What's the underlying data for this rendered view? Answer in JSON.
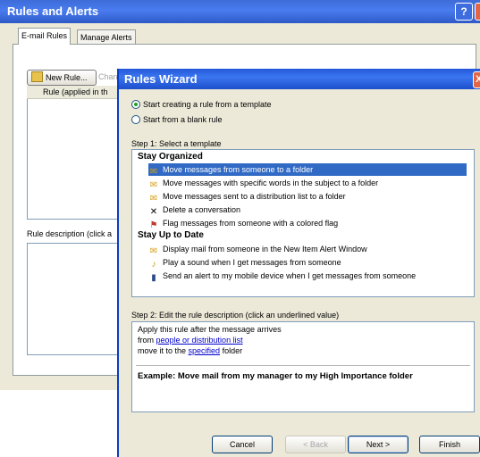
{
  "background_dialog": {
    "title": "Rules and Alerts",
    "help_button": "?",
    "tabs": [
      "E-mail Rules",
      "Manage Alerts"
    ],
    "new_rule_label": "New Rule...",
    "change_rule_partial": "Chan",
    "rule_column_header": "Rule (applied in th",
    "rule_description_label": "Rule description (click a"
  },
  "wizard": {
    "title": "Rules Wizard",
    "close_glyph": "X",
    "start_options": [
      {
        "label": "Start creating a rule from a template",
        "selected": true
      },
      {
        "label": "Start from a blank rule",
        "selected": false
      }
    ],
    "step1_label": "Step 1: Select a template",
    "groups": [
      {
        "name": "Stay Organized",
        "items": [
          {
            "label": "Move messages from someone to a folder",
            "icon": "folder-person-icon",
            "glyph": "✉",
            "selected": true
          },
          {
            "label": "Move messages with specific words in the subject to a folder",
            "icon": "folder-doc-icon",
            "glyph": "✉",
            "selected": false
          },
          {
            "label": "Move messages sent to a distribution list to a folder",
            "icon": "folder-list-icon",
            "glyph": "✉",
            "selected": false
          },
          {
            "label": "Delete a conversation",
            "icon": "delete-x-icon",
            "glyph": "✕",
            "selected": false
          },
          {
            "label": "Flag messages from someone with a colored flag",
            "icon": "flag-icon",
            "glyph": "⚑",
            "selected": false
          }
        ]
      },
      {
        "name": "Stay Up to Date",
        "items": [
          {
            "label": "Display mail from someone in the New Item Alert Window",
            "icon": "alert-window-icon",
            "glyph": "✉",
            "selected": false
          },
          {
            "label": "Play a sound when I get messages from someone",
            "icon": "speaker-icon",
            "glyph": "♪",
            "selected": false
          },
          {
            "label": "Send an alert to my mobile device when I get messages from someone",
            "icon": "mobile-device-icon",
            "glyph": "▮",
            "selected": false
          }
        ]
      }
    ],
    "step2_label": "Step 2: Edit the rule description (click an underlined value)",
    "description": {
      "line1": "Apply this rule after the message arrives",
      "line2_prefix": "from ",
      "line2_link": "people or distribution list",
      "line3_prefix": "move it to the ",
      "line3_link": "specified",
      "line3_suffix": " folder",
      "example": "Example: Move mail from my manager to my High Importance folder"
    },
    "buttons": {
      "cancel": "Cancel",
      "back": "< Back",
      "next": "Next >",
      "finish": "Finish"
    }
  },
  "colors": {
    "title_bar": "#2457d8",
    "selection": "#316ac5",
    "dialog_face": "#ece9d8",
    "link": "#0000cc"
  }
}
